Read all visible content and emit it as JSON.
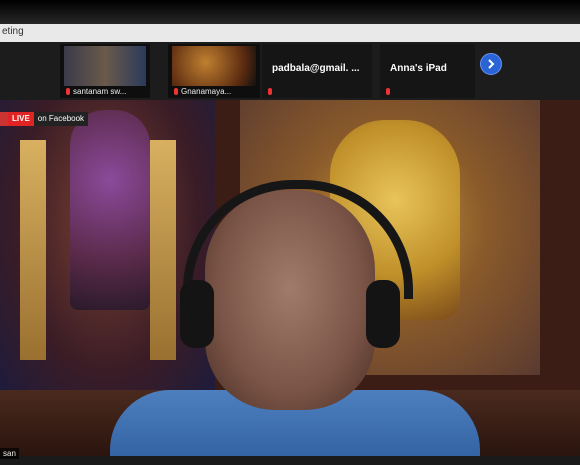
{
  "window": {
    "title": "eting"
  },
  "participants": [
    {
      "name": "santanam sw..."
    },
    {
      "name": "Gnanamaya..."
    },
    {
      "name": "padbala@gmail. ..."
    },
    {
      "name": "Anna's iPad"
    }
  ],
  "next_button": {
    "icon": "chevron-right-icon"
  },
  "live": {
    "badge": "LIVE",
    "text": "on Facebook"
  },
  "speaker": {
    "name_fragment": "san"
  },
  "colors": {
    "accent": "#2a63d6",
    "live": "#e02424",
    "mic_off": "#e33333"
  }
}
